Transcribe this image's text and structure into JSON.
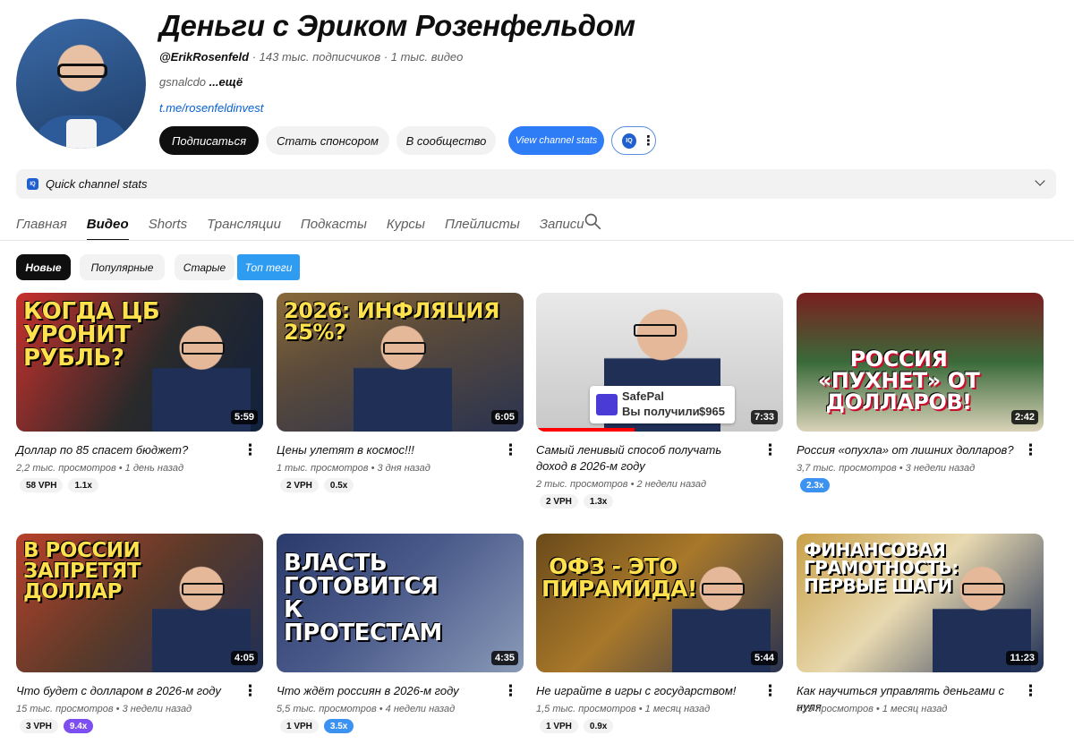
{
  "channel": {
    "title": "Деньги с Эриком Розенфельдом",
    "handle": "@ErikRosenfeld",
    "stats": " · 143 тыс. подписчиков · 1 тыс. видео",
    "description": "gsnalcdo ",
    "more": "...ещё",
    "link": "t.me/rosenfeldinvest"
  },
  "buttons": {
    "subscribe": "Подписаться",
    "sponsor": "Стать спонсором",
    "community": "В сообщество",
    "stats": "View channel stats",
    "iq": "IQ"
  },
  "quick_stats": {
    "label": "Quick channel stats",
    "icon": "IQ"
  },
  "tabs": [
    "Главная",
    "Видео",
    "Shorts",
    "Трансляции",
    "Подкасты",
    "Курсы",
    "Плейлисты",
    "Записи"
  ],
  "active_tab": "Видео",
  "chips": {
    "new": "Новые",
    "popular": "Популярные",
    "old": "Старые",
    "top_tags": "Топ теги"
  },
  "videos": [
    {
      "title": "Доллар по 85 спасет бюджет?",
      "thumb_text": "КОГДА ЦБ УРОНИТ РУБЛЬ?",
      "duration": "5:59",
      "views": "2,2 тыс. просмотров",
      "age": "1 день назад",
      "vph": "58 VPH",
      "ratio": "1.1x",
      "ratio_color": "grey"
    },
    {
      "title": "Цены улетят в космос!!!",
      "thumb_text": "2026: ИНФЛЯЦИЯ 25%?",
      "duration": "6:05",
      "views": "1 тыс. просмотров",
      "age": "3 дня назад",
      "vph": "2 VPH",
      "ratio": "0.5x",
      "ratio_color": "grey"
    },
    {
      "title": "Самый ленивый способ получать доход в 2026-м году",
      "thumb_text": "",
      "sp_brand": "SafePal",
      "sp_text": "Вы получили",
      "sp_amount": "$965",
      "duration": "7:33",
      "views": "2 тыс. просмотров",
      "age": "2 недели назад",
      "vph": "2 VPH",
      "ratio": "1.3x",
      "ratio_color": "grey"
    },
    {
      "title": "Россия «опухла» от лишних долларов?",
      "thumb_text": "РОССИЯ «ПУХНЕТ» ОТ ДОЛЛАРОВ!",
      "duration": "2:42",
      "views": "3,7 тыс. просмотров",
      "age": "3 недели назад",
      "vph": "",
      "ratio": "2.3x",
      "ratio_color": "blue"
    },
    {
      "title": "Что будет с долларом в 2026-м году",
      "thumb_text": "В РОССИИ ЗАПРЕТЯТ ДОЛЛАР",
      "duration": "4:05",
      "views": "15 тыс. просмотров",
      "age": "3 недели назад",
      "vph": "3 VPH",
      "ratio": "9.4x",
      "ratio_color": "purple"
    },
    {
      "title": "Что ждёт россиян в 2026-м году",
      "thumb_text": "ВЛАСТЬ ГОТОВИТСЯ К ПРОТЕСТАМ",
      "duration": "4:35",
      "views": "5,5 тыс. просмотров",
      "age": "4 недели назад",
      "vph": "1 VPH",
      "ratio": "3.5x",
      "ratio_color": "blue"
    },
    {
      "title": "Не играйте в игры с государством!",
      "thumb_text": "ОФЗ - ЭТО ПИРАМИДА!",
      "duration": "5:44",
      "views": "1,5 тыс. просмотров",
      "age": "1 месяц назад",
      "vph": "1 VPH",
      "ratio": "0.9x",
      "ratio_color": "grey"
    },
    {
      "title": "Как научиться управлять деньгами с нуля",
      "thumb_text": "ФИНАНСОВАЯ ГРАМОТНОСТЬ: ПЕРВЫЕ ШАГИ",
      "duration": "11:23",
      "views": "719 просмотров",
      "age": "1 месяц назад",
      "vph": "",
      "ratio": "",
      "ratio_color": "grey"
    }
  ],
  "meta_separator": " • ",
  "colors": {
    "accent_blue": "#2e7cf6",
    "chip_blue": "#2e9cf0",
    "pill_purple": "#7d4ff0"
  }
}
